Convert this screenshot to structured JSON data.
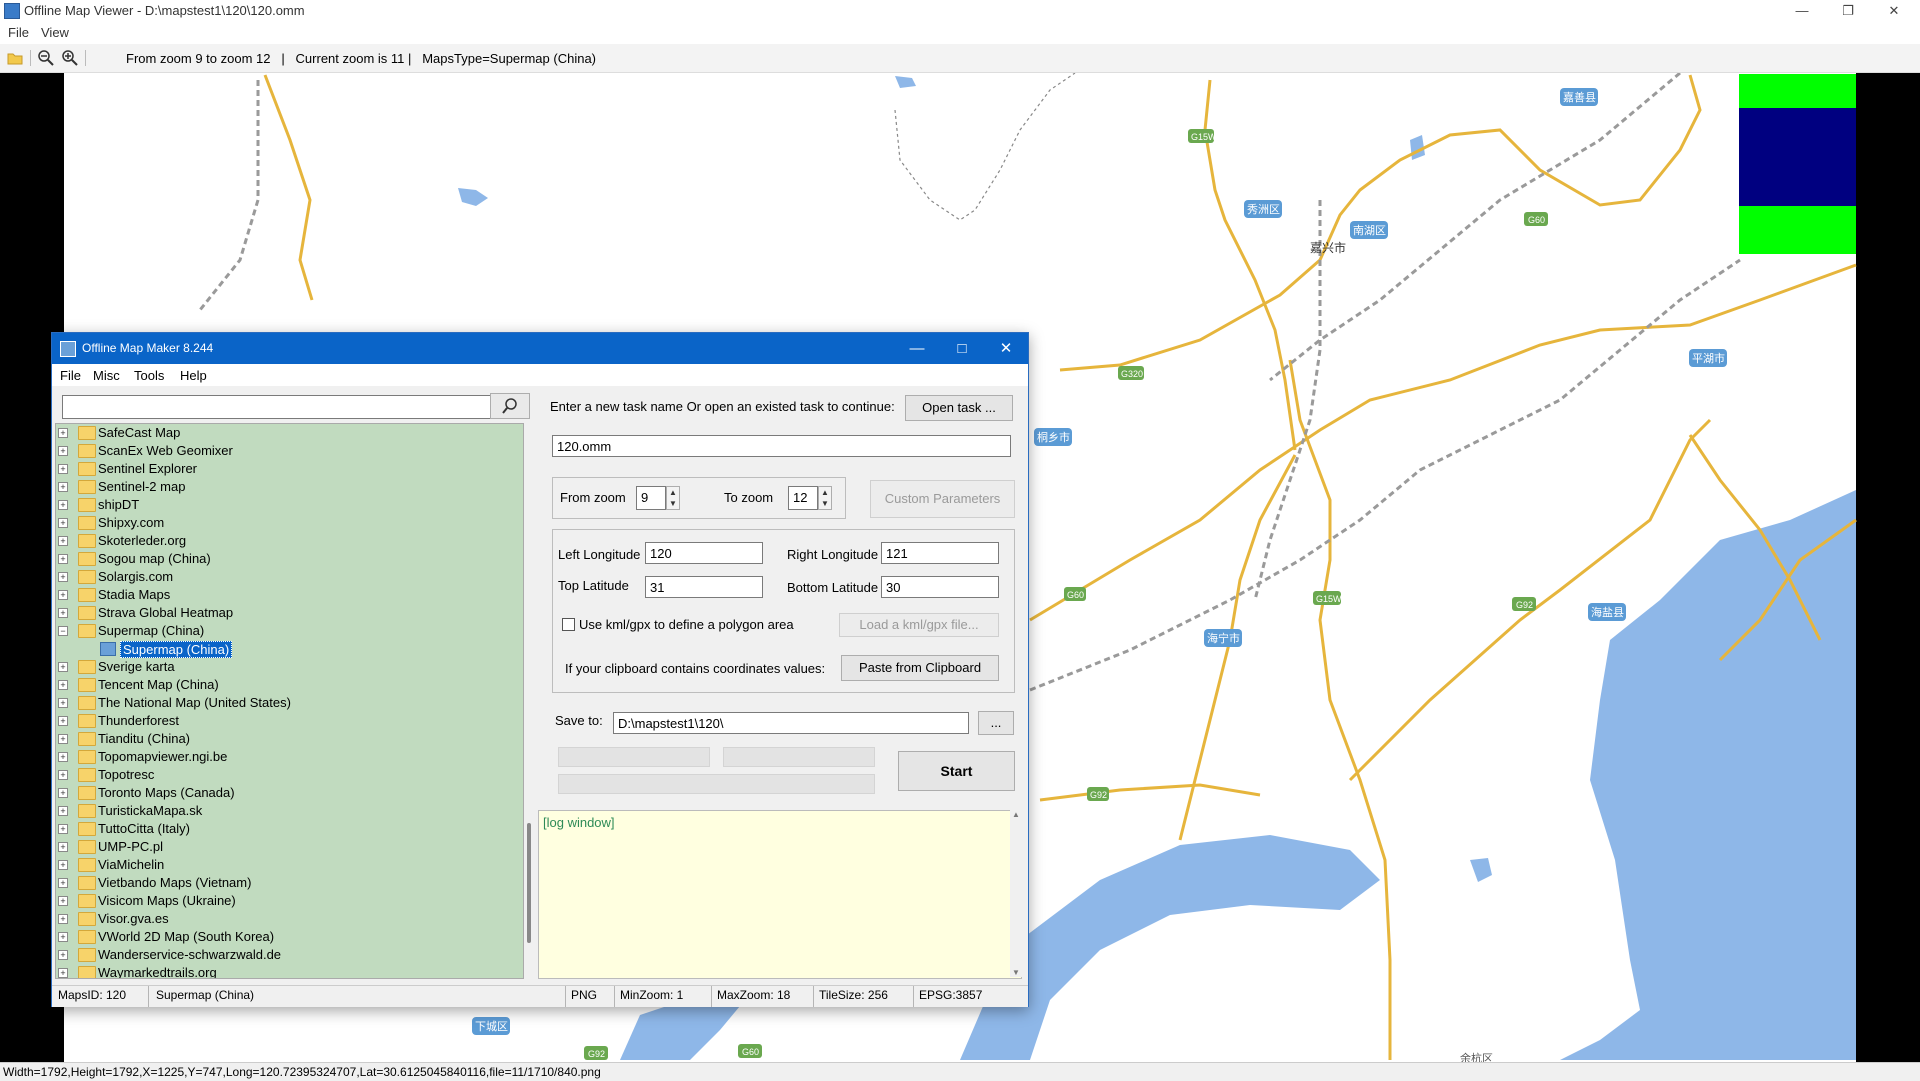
{
  "viewer": {
    "title": "Offline Map Viewer - D:\\mapstest1\\120\\120.omm",
    "menu": [
      "File",
      "View"
    ],
    "toolbar_info": "From zoom 9 to zoom 12   |   Current zoom is 11 |   MapsType=Supermap (China)",
    "status": "Width=1792,Height=1792,X=1225,Y=747,Long=120.72395324707,Lat=30.6125045840116,file=11/1710/840.png"
  },
  "map": {
    "place_labels": [
      "嘉善县",
      "秀洲区",
      "南湖区",
      "嘉兴市",
      "平湖市",
      "桐乡市",
      "海宁市",
      "海盐县",
      "下城区",
      "余杭区"
    ],
    "road_labels": [
      "G15W",
      "G60",
      "G320",
      "G60",
      "G15W",
      "G92",
      "G92",
      "G92",
      "G60"
    ],
    "colors": {
      "water": "#8eb7e8",
      "road": "#e6b53c",
      "rail": "#9a9a9a",
      "label_bg": "#5b9bd5",
      "shield_bg": "#6aa84f"
    }
  },
  "dialog": {
    "title": "Offline Map Maker 8.244",
    "menu": [
      "File",
      "Misc",
      "Tools",
      "Help"
    ],
    "search_value": "",
    "tree_items": [
      "SafeCast Map",
      "ScanEx Web Geomixer",
      "Sentinel Explorer",
      "Sentinel-2 map",
      "shipDT",
      "Shipxy.com",
      "Skoterleder.org",
      "Sogou map (China)",
      "Solargis.com",
      "Stadia Maps",
      "Strava Global Heatmap",
      "Supermap (China)",
      "Supermap (China)",
      "Sverige karta",
      "Tencent Map (China)",
      "The National Map (United States)",
      "Thunderforest",
      "Tianditu (China)",
      "Topomapviewer.ngi.be",
      "Topotresc",
      "Toronto Maps (Canada)",
      "TuristickaMapa.sk",
      "TuttoCitta (Italy)",
      "UMP-PC.pl",
      "ViaMichelin",
      "Vietbando Maps (Vietnam)",
      "Visicom Maps (Ukraine)",
      "Visor.gva.es",
      "VWorld 2D Map (South Korea)",
      "Wanderservice-schwarzwald.de",
      "Waymarkedtrails.org"
    ],
    "task_prompt": "Enter a new task name Or open an existed task to continue:",
    "open_task": "Open task ...",
    "task_name": "120.omm",
    "from_zoom_label": "From zoom",
    "from_zoom": "9",
    "to_zoom_label": "To zoom",
    "to_zoom": "12",
    "custom_params": "Custom Parameters",
    "left_lon_label": "Left Longitude",
    "left_lon": "120",
    "right_lon_label": "Right Longitude",
    "right_lon": "121",
    "top_lat_label": "Top Latitude",
    "top_lat": "31",
    "bottom_lat_label": "Bottom Latitude",
    "bottom_lat": "30",
    "kml_check_label": "Use kml/gpx to define a polygon area",
    "kml_checked": false,
    "load_kml": "Load a kml/gpx file...",
    "clipboard_prompt": "If your clipboard contains coordinates values:",
    "paste_clipboard": "Paste from Clipboard",
    "save_to_label": "Save to:",
    "save_to": "D:\\mapstest1\\120\\",
    "browse": "...",
    "start": "Start",
    "log_text": "[log window]",
    "status": {
      "maps_id": "MapsID: 120",
      "map_name": "Supermap (China)",
      "format": "PNG",
      "min_zoom": "MinZoom: 1",
      "max_zoom": "MaxZoom: 18",
      "tile_size": "TileSize: 256",
      "epsg": "EPSG:3857"
    }
  }
}
